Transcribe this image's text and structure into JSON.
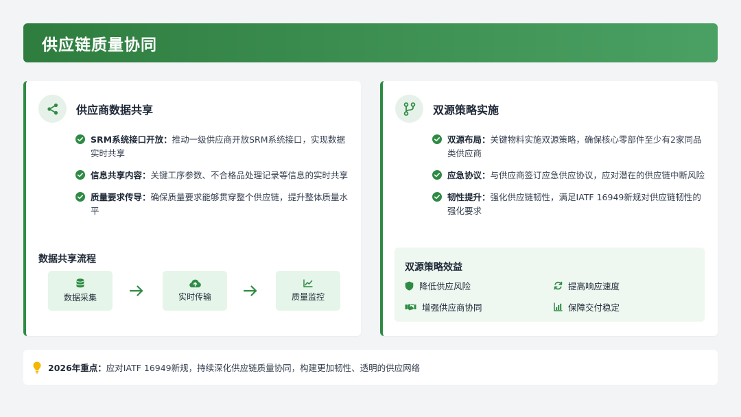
{
  "header": {
    "title": "供应链质量协同"
  },
  "left_card": {
    "title": "供应商数据共享",
    "icon": "share-icon",
    "items": [
      {
        "label": "SRM系统接口开放：",
        "text": "推动一级供应商开放SRM系统接口，实现数据实时共享"
      },
      {
        "label": "信息共享内容：",
        "text": "关键工序参数、不合格品处理记录等信息的实时共享"
      },
      {
        "label": "质量要求传导：",
        "text": "确保质量要求能够贯穿整个供应链，提升整体质量水平"
      }
    ],
    "flow_title": "数据共享流程",
    "flow": [
      {
        "label": "数据采集",
        "icon": "database-icon"
      },
      {
        "label": "实时传输",
        "icon": "cloud-upload-icon"
      },
      {
        "label": "质量监控",
        "icon": "line-chart-icon"
      }
    ]
  },
  "right_card": {
    "title": "双源策略实施",
    "icon": "branch-icon",
    "items": [
      {
        "label": "双源布局：",
        "text": "关键物料实施双源策略，确保核心零部件至少有2家同品类供应商"
      },
      {
        "label": "应急协议：",
        "text": "与供应商签订应急供应协议，应对潜在的供应链中断风险"
      },
      {
        "label": "韧性提升：",
        "text": "强化供应链韧性，满足IATF 16949新规对供应链韧性的强化要求"
      }
    ],
    "benefit_title": "双源策略效益",
    "benefits": [
      {
        "label": "降低供应风险",
        "icon": "shield-icon"
      },
      {
        "label": "提高响应速度",
        "icon": "sync-icon"
      },
      {
        "label": "增强供应商协同",
        "icon": "handshake-icon"
      },
      {
        "label": "保障交付稳定",
        "icon": "bar-chart-icon"
      }
    ]
  },
  "footer": {
    "icon": "lightbulb-icon",
    "label": "2026年重点：",
    "text": "应对IATF 16949新规，持续深化供应链质量协同，构建更加韧性、透明的供应网络"
  },
  "colors": {
    "primary": "#2e8b44",
    "light": "#e6f5e9",
    "accent_yellow": "#f5b700"
  }
}
